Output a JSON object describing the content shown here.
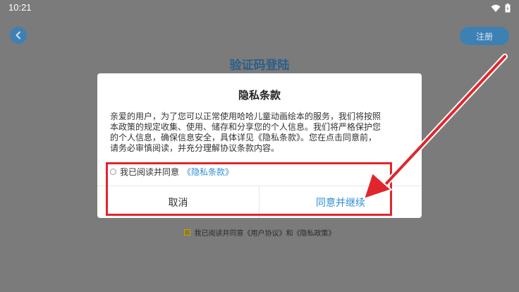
{
  "status_bar": {
    "time": "10:21"
  },
  "header": {
    "register_label": "注册",
    "title": "验证码登陆"
  },
  "dialog": {
    "title": "隐私条款",
    "body_lines": [
      "亲爱的用户，为了您可以正常使用哈哈儿童动画绘本的服务，我们将按照",
      "本政策的规定收集、使用、储存和分享您的个人信息。我们将严格保护您",
      "的个人信息，确保信息安全，具体详见《隐私条款》。您在点击同意前，",
      "请务必审慎阅读，并充分理解协议条款内容。"
    ],
    "check_label": "我已阅读并同意",
    "check_link": "《隐私条款》",
    "cancel_label": "取消",
    "confirm_label": "同意并继续"
  },
  "bottom_agreement": {
    "text": "我已阅读并同意《用户协议》和《隐私政策》"
  },
  "colors": {
    "overlay": "#7b7b7b",
    "accent": "#2f8fd6",
    "annotation": "#e0262c"
  }
}
